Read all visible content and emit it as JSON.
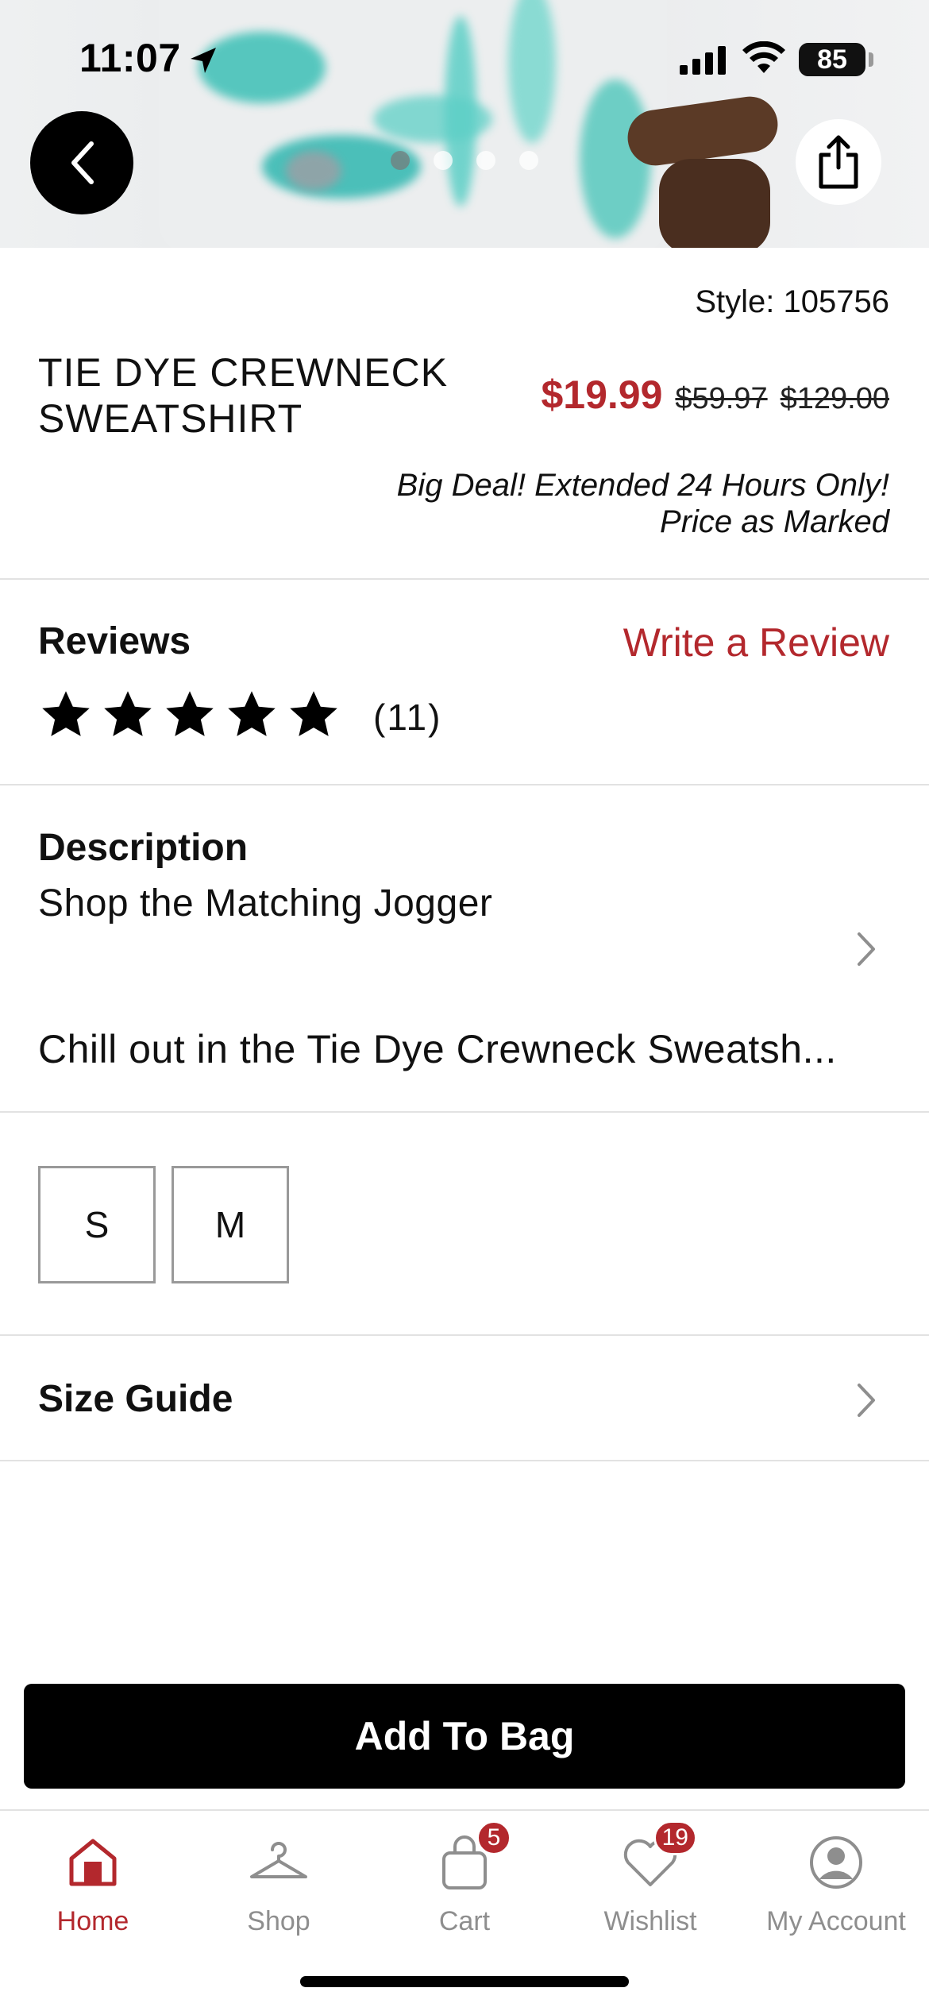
{
  "status_bar": {
    "time": "11:07",
    "battery": "85"
  },
  "product": {
    "style": "Style: 105756",
    "title": "TIE DYE CREWNECK SWEATSHIRT",
    "price_current": "$19.99",
    "price_was_1": "$59.97",
    "price_was_2": "$129.00",
    "promo_line_1": "Big Deal! Extended 24 Hours Only!",
    "promo_line_2": "Price as Marked",
    "carousel_pages": 4
  },
  "reviews": {
    "heading": "Reviews",
    "write_review": "Write a Review",
    "rating": 5,
    "count": "(11)"
  },
  "description": {
    "heading": "Description",
    "subtitle": "Shop the Matching Jogger",
    "body": "Chill out in the Tie Dye Crewneck Sweatsh..."
  },
  "sizes": [
    "S",
    "M"
  ],
  "size_guide": "Size Guide",
  "add_to_bag": "Add To Bag",
  "tabs": [
    {
      "label": "Home",
      "icon": "home-icon",
      "active": true
    },
    {
      "label": "Shop",
      "icon": "hanger-icon"
    },
    {
      "label": "Cart",
      "icon": "bag-icon",
      "badge": "5"
    },
    {
      "label": "Wishlist",
      "icon": "heart-icon",
      "badge": "19"
    },
    {
      "label": "My Account",
      "icon": "account-icon"
    }
  ],
  "colors": {
    "accent": "#b3282d",
    "tie_dye": "#2fb7b0"
  }
}
